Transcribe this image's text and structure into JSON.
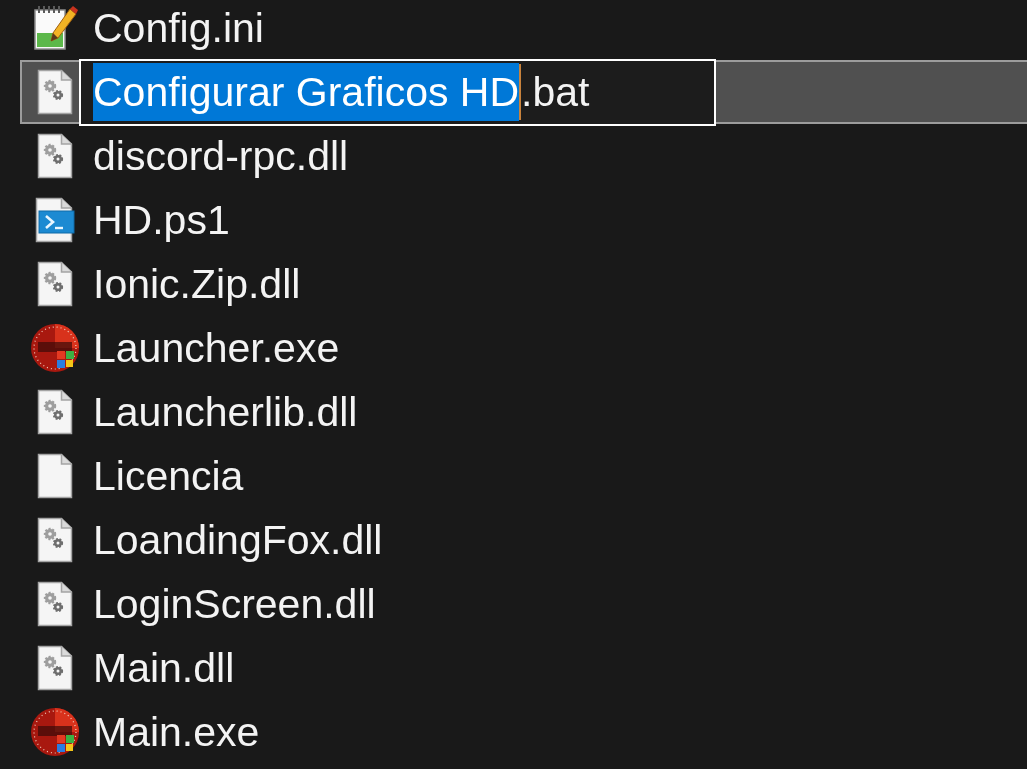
{
  "files": [
    {
      "name": "Config.ini",
      "kind": "notepad",
      "selected": false
    },
    {
      "kind": "gears",
      "selected": true,
      "rename_field": {
        "selected_text": "Configurar Graficos HD",
        "unselected_text": ".bat"
      }
    },
    {
      "name": "discord-rpc.dll",
      "kind": "gears",
      "selected": false
    },
    {
      "name": "HD.ps1",
      "kind": "powershell",
      "selected": false
    },
    {
      "name": "Ionic.Zip.dll",
      "kind": "gears",
      "selected": false
    },
    {
      "name": "Launcher.exe",
      "kind": "app",
      "selected": false
    },
    {
      "name": "Launcherlib.dll",
      "kind": "gears",
      "selected": false
    },
    {
      "name": "Licencia",
      "kind": "blank",
      "selected": false
    },
    {
      "name": "LoandingFox.dll",
      "kind": "gears",
      "selected": false
    },
    {
      "name": "LoginScreen.dll",
      "kind": "gears",
      "selected": false
    },
    {
      "name": "Main.dll",
      "kind": "gears",
      "selected": false
    },
    {
      "name": "Main.exe",
      "kind": "app",
      "selected": false
    }
  ]
}
